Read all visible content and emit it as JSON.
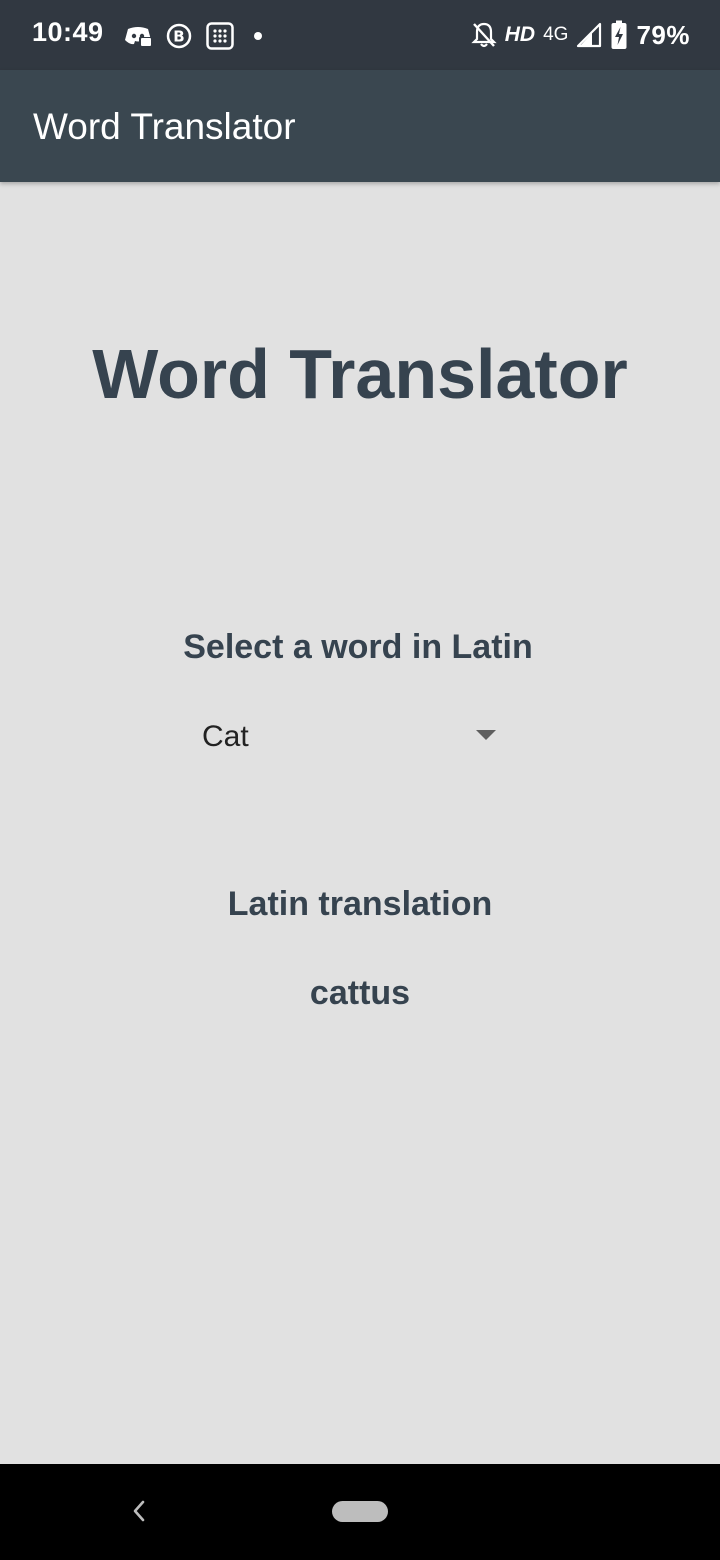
{
  "status_bar": {
    "time": "10:49",
    "left_icons": [
      "discord-icon",
      "bitcoin-icon",
      "calculator-icon",
      "notification-dot-icon"
    ],
    "hd_label": "HD",
    "network_label": "4G",
    "battery_percent": "79%",
    "right_icons": [
      "notifications-off-icon",
      "signal-icon",
      "battery-charging-icon"
    ]
  },
  "app_bar": {
    "title": "Word Translator"
  },
  "main": {
    "heading": "Word Translator",
    "select_label": "Select a word in Latin",
    "selected_word": "Cat",
    "translation_label": "Latin translation",
    "translation_value": "cattus"
  },
  "nav_bar": {
    "icons": [
      "back-icon",
      "home-pill-icon"
    ]
  },
  "colors": {
    "status_bar_bg": "#313841",
    "app_bar_bg": "#3a4750",
    "page_bg": "#e1e1e1",
    "heading_text": "#36434f",
    "nav_bar_bg": "#000000"
  }
}
